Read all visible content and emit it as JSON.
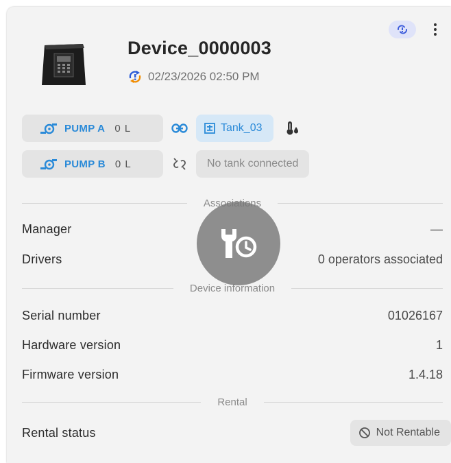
{
  "device": {
    "name": "Device_0000003",
    "timestamp": "02/23/2026 02:50 PM",
    "status_icon": "sync-alert-icon"
  },
  "header_actions": {
    "sync_icon": "sync-icon",
    "menu_icon": "more-vertical-icon"
  },
  "pumps": [
    {
      "name": "PUMP A",
      "volume": "0 L",
      "link": "linked",
      "tank": "Tank_03"
    },
    {
      "name": "PUMP B",
      "volume": "0 L",
      "link": "unlinked",
      "tank": "No tank connected"
    }
  ],
  "sections": {
    "associations": "Associations",
    "device_info": "Device information",
    "rental": "Rental"
  },
  "associations": {
    "manager_label": "Manager",
    "manager_value": "—",
    "drivers_label": "Drivers",
    "drivers_value": "0 operators associated"
  },
  "device_info": {
    "serial_label": "Serial number",
    "serial_value": "01026167",
    "hardware_label": "Hardware version",
    "hardware_value": "1",
    "firmware_label": "Firmware version",
    "firmware_value": "1.4.18"
  },
  "rental": {
    "status_label": "Rental status",
    "status_value": "Not Rentable"
  },
  "colors": {
    "accent": "#2a8ad8",
    "card_bg": "#f3f3f3",
    "chip_bg": "#e4e4e4",
    "tank_chip_bg": "#d6e8f7",
    "sync_badge_bg": "#dfe3f9",
    "overlay": "#787878"
  }
}
